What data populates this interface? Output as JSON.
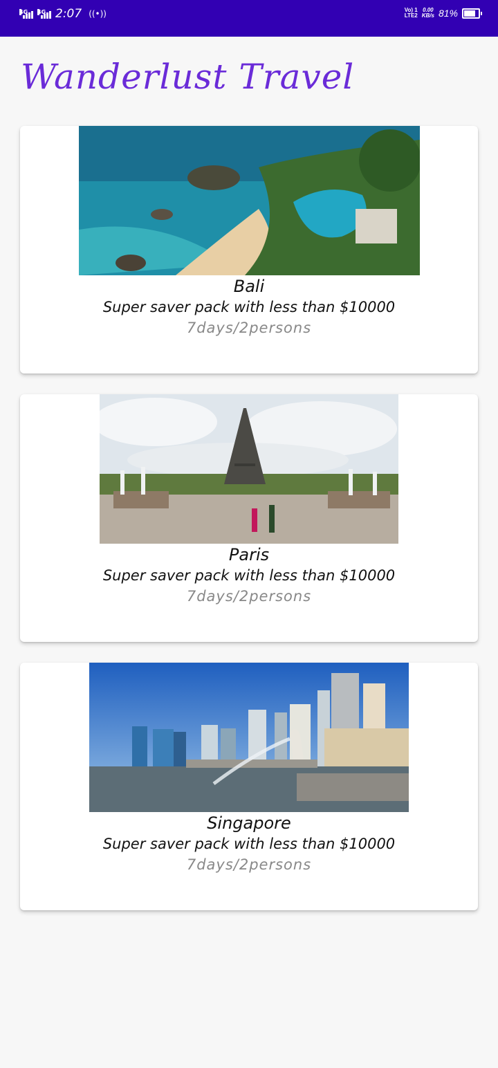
{
  "status_bar": {
    "network_1": "4G",
    "network_2": "4G",
    "time": "2:07",
    "volte_line1": "Vo) 1",
    "volte_line2": "LTE2",
    "speed_value": "0.00",
    "speed_unit": "KB/s",
    "battery": "81%"
  },
  "app": {
    "title": "Wanderlust Travel"
  },
  "cards": [
    {
      "city": "Bali",
      "description": "Super saver pack with less than $10000",
      "duration": "7days/2persons"
    },
    {
      "city": "Paris",
      "description": "Super saver pack with less than $10000",
      "duration": "7days/2persons"
    },
    {
      "city": "Singapore",
      "description": "Super saver pack with less than $10000",
      "duration": "7days/2persons"
    }
  ],
  "colors": {
    "status_bar": "#3200b3",
    "title": "#6a2bd8"
  }
}
